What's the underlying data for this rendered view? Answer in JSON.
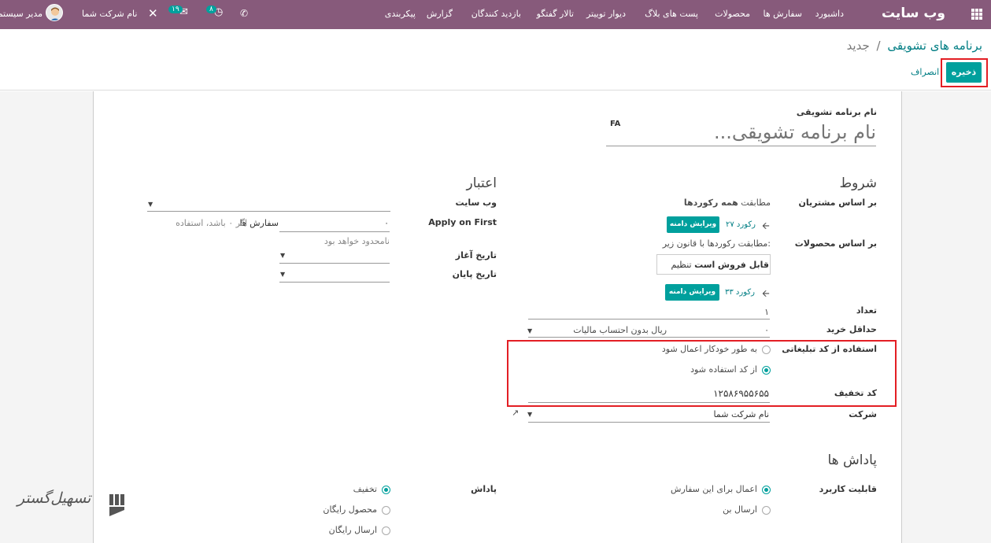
{
  "topbar": {
    "app_title": "وب سایت",
    "menu": [
      "داشبورد",
      "سفارش ها",
      "محصولات",
      "پست های بلاگ",
      "دیوار توییتر",
      "تالار گفتگو",
      "بازدید کنندگان",
      "گزارش",
      "پیکربندی"
    ],
    "company": "نام شرکت شما",
    "user": "مدیر سیستم",
    "messages_count": "۱۹",
    "activities_count": "۸"
  },
  "header": {
    "breadcrumb_parent": "برنامه های تشویقی",
    "breadcrumb_sep": "/",
    "breadcrumb_current": "جدید",
    "save_label": "ذخیره",
    "discard_label": "انصراف"
  },
  "form": {
    "name_label": "نام برنامه تشویقی",
    "name_placeholder": "نام برنامه تشویقی...",
    "lang_badge": "FA",
    "conditions_title": "شروط",
    "customers_label": "بر اساس مشتریان",
    "customers_match_prefix": "مطابقت",
    "customers_match_bold": "همه رکوردها",
    "customers_records": "۲۷ رکورد",
    "edit_domain_label": "ویرایش دامنه",
    "products_label": "بر اساس محصولات",
    "products_rule_text": "مطابقت رکوردها با قانون زیر:",
    "rule_field": "قابل فروش",
    "rule_op": "است",
    "rule_value": "تنظیم",
    "products_records": "۳۳ رکورد",
    "quantity_label": "تعداد",
    "quantity_value": "۱",
    "min_purchase_label": "حداقل خرید",
    "min_purchase_value": "۰",
    "tax_option": "ریال  بدون احتساب مالیات",
    "promo_usage_label": "استفاده از کد تبلیغاتی",
    "promo_opt_auto": "به طور خودکار اعمال شود",
    "promo_opt_code": "از کد استفاده شود",
    "discount_code_label": "کد تخفیف",
    "discount_code_value": "۱۲۵۸۶۹۵۵۶۵۵",
    "company_label": "شرکت",
    "company_value": "نام شرکت شما",
    "validity_title": "اعتبار",
    "website_label": "وب سایت",
    "apply_first_label": "Apply on First",
    "apply_first_value": "۰",
    "apply_first_unit": "سفارش ها",
    "apply_first_hint": "اگر ۰ باشد، استفاده",
    "apply_first_hint2": "نامحدود خواهد بود",
    "start_date_label": "تاریخ آغاز",
    "end_date_label": "تاریخ پایان",
    "rewards_title": "پاداش ها",
    "applicability_label": "قابلیت کاربرد",
    "appl_opt_current": "اعمال برای این سفارش",
    "appl_opt_coupon": "ارسال بن",
    "reward_label": "پاداش",
    "reward_opt_discount": "تخفیف",
    "reward_opt_free_product": "محصول رایگان",
    "reward_opt_free_shipping": "ارسال رایگان"
  },
  "watermark": "تسهیل‌گستر",
  "colors": {
    "brand": "#875a7b",
    "primary_button": "#00a09d",
    "highlight": "#e31e24"
  }
}
